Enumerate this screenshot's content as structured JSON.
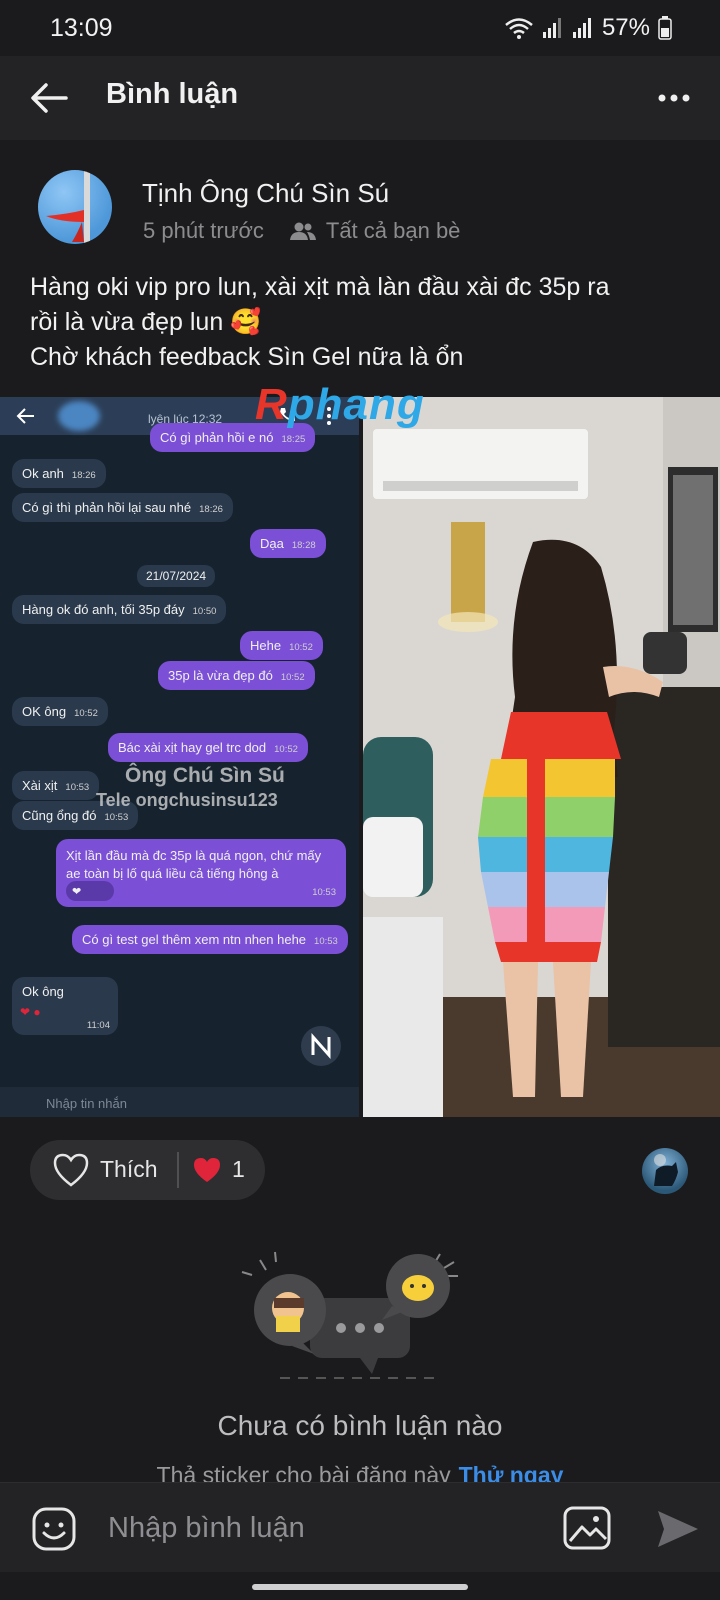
{
  "status_bar": {
    "time": "13:09",
    "battery": "57%"
  },
  "header": {
    "title": "Bình luận"
  },
  "post": {
    "author": "Tịnh Ông Chú Sìn Sú",
    "time_ago": "5 phút trước",
    "audience": "Tất cả bạn bè",
    "text_lines": [
      "Hàng oki vip pro lun, xài xịt mà làn đầu xài đc 35p ra",
      "rồi là vừa đẹp lun 🥰",
      "Chờ khách feedback Sìn Gel nữa là ổn"
    ]
  },
  "chat_screenshot": {
    "top_status": "lyên lúc 12:32",
    "date_chip": "21/07/2024",
    "messages": [
      {
        "text": "Có gì phản hồi e nó",
        "time": "18:25",
        "dir": "out"
      },
      {
        "text": "Ok anh",
        "time": "18:26",
        "dir": "in"
      },
      {
        "text": "Có gì thì phản hồi lại sau nhé",
        "time": "18:26",
        "dir": "in"
      },
      {
        "text": "Dạa",
        "time": "18:28",
        "dir": "out"
      },
      {
        "text": "Hàng ok đó anh,  tối 35p đáy",
        "time": "10:50",
        "dir": "in"
      },
      {
        "text": "Hehe",
        "time": "10:52",
        "dir": "out"
      },
      {
        "text": "35p là vừa đẹp đó",
        "time": "10:52",
        "dir": "out"
      },
      {
        "text": "OK ông",
        "time": "10:52",
        "dir": "in"
      },
      {
        "text": "Bác xài xịt hay gel trc dod",
        "time": "10:52",
        "dir": "out"
      },
      {
        "text": "Xài xịt",
        "time": "10:53",
        "dir": "in"
      },
      {
        "text": "Cũng ổng đó",
        "time": "10:53",
        "dir": "in"
      },
      {
        "text": "Xịt lần đầu mà đc 35p là quá ngon, chứ mấy ae toàn bị lố quá liều cả tiếng hông à",
        "time": "10:53",
        "dir": "out"
      },
      {
        "text": "Có gì test gel thêm xem ntn nhen hehe",
        "time": "10:53",
        "dir": "out"
      },
      {
        "text": "Ok ông",
        "time": "11:04",
        "dir": "in"
      }
    ],
    "watermark_name": "Ông Chú Sìn Sú",
    "watermark_tele": "Tele ongchusinsu123",
    "brand": "phang",
    "input_placeholder": "Nhập tin nhắn"
  },
  "reactions": {
    "like_label": "Thích",
    "heart_count": "1"
  },
  "empty_state": {
    "title": "Chưa có bình luận nào",
    "subtitle": "Thả sticker cho bài đăng này",
    "cta": "Thử ngay"
  },
  "comment_bar": {
    "placeholder": "Nhập bình luận"
  },
  "colors": {
    "background": "#1b1b1d",
    "header": "#232325",
    "accent_link": "#3b8de7",
    "heart": "#e0243a",
    "bubble_out": "#7b4fd6"
  },
  "icons": [
    "back-arrow-icon",
    "more-dots-icon",
    "friends-icon",
    "heart-outline-icon",
    "heart-filled-icon",
    "sticker-smile-icon",
    "image-icon",
    "send-icon",
    "wifi-icon",
    "signal-icon",
    "battery-icon"
  ]
}
